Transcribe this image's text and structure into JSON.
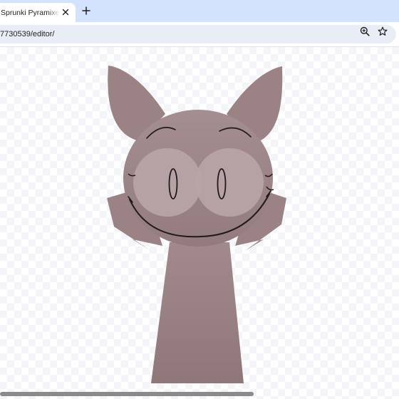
{
  "browser": {
    "tab": {
      "title": "Sprunki Pyramixed E",
      "close_icon": "close-icon"
    },
    "new_tab_icon": "plus-icon",
    "address_bar": {
      "url": "7730539/editor/",
      "icons": [
        "zoom-icon",
        "star-icon"
      ]
    }
  },
  "page": {
    "background": "transparency-checkerboard",
    "subject": "sprunki-character",
    "colors": {
      "body": "#9c8487",
      "body_light": "#a99295",
      "body_dark": "#8d7478",
      "eye_disc": "#b8a4a6",
      "line": "#1f1a1b"
    }
  },
  "scrollbar": {
    "horizontal_position": 0.64
  }
}
